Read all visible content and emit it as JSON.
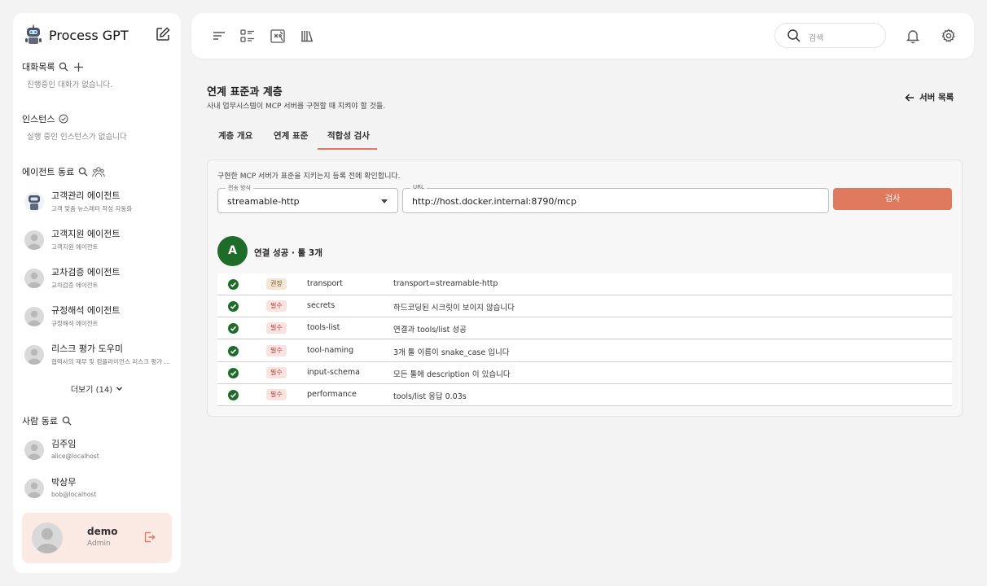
{
  "brand": {
    "title": "Process GPT"
  },
  "sidebar": {
    "chats": {
      "label": "대화목록",
      "empty": "진행중인 대화가 없습니다."
    },
    "instances": {
      "label": "인스턴스",
      "empty": "실행 중인 인스턴스가 없습니다"
    },
    "agents": {
      "label": "에이전트 동료",
      "items": [
        {
          "name": "고객관리 에이전트",
          "desc": "고객 맞춤 뉴스레터 작성 자동화"
        },
        {
          "name": "고객지원 에이전트",
          "desc": "고객지원 에이전트"
        },
        {
          "name": "교차검증 에이전트",
          "desc": "교차검증 에이전트"
        },
        {
          "name": "규정해석 에이전트",
          "desc": "규정해석 에이전트"
        },
        {
          "name": "리스크 평가 도우미",
          "desc": "협력사의 재무 및 컴플라이언스 리스크 평가 ..."
        }
      ],
      "more": "더보기 (14)"
    },
    "people": {
      "label": "사람 동료",
      "items": [
        {
          "name": "김주임",
          "email": "alice@localhost"
        },
        {
          "name": "박상무",
          "email": "bob@localhost"
        }
      ]
    },
    "user": {
      "name": "demo",
      "role": "Admin"
    }
  },
  "topbar": {
    "search_placeholder": "검색"
  },
  "main": {
    "title": "연계 표준과 계층",
    "subtitle": "사내 업무시스템이 MCP 서버를 구현할 때 지켜야 할 것들.",
    "back": "서버 목록",
    "tabs": [
      "계층 개요",
      "연계 표준",
      "적합성 검사"
    ],
    "active_tab": "적합성 검사",
    "panel": {
      "desc": "구현한 MCP 서버가 표준을 지키는지 등록 전에 확인합니다.",
      "transport_label": "전송 방식",
      "transport_value": "streamable-http",
      "url_label": "URL",
      "url_value": "http://host.docker.internal:8790/mcp",
      "check_button": "검사",
      "grade": "A",
      "result": "연결 성공 · 툴 3개",
      "checks": [
        {
          "level": "권장",
          "kind": "rec",
          "key": "transport",
          "msg": "transport=streamable-http"
        },
        {
          "level": "필수",
          "kind": "req",
          "key": "secrets",
          "msg": "하드코딩된 시크릿이 보이지 않습니다"
        },
        {
          "level": "필수",
          "kind": "req",
          "key": "tools-list",
          "msg": "연결과 tools/list 성공"
        },
        {
          "level": "필수",
          "kind": "req",
          "key": "tool-naming",
          "msg": "3개 툴 이름이 snake_case 입니다"
        },
        {
          "level": "필수",
          "kind": "req",
          "key": "input-schema",
          "msg": "모든 툴에 description 이 있습니다"
        },
        {
          "level": "필수",
          "kind": "req",
          "key": "performance",
          "msg": "tools/list 응답 0.03s"
        }
      ]
    }
  },
  "colors": {
    "accent": "#e07a5f",
    "grade_bg": "#1f6b2a",
    "ok": "#1f6b2a"
  }
}
